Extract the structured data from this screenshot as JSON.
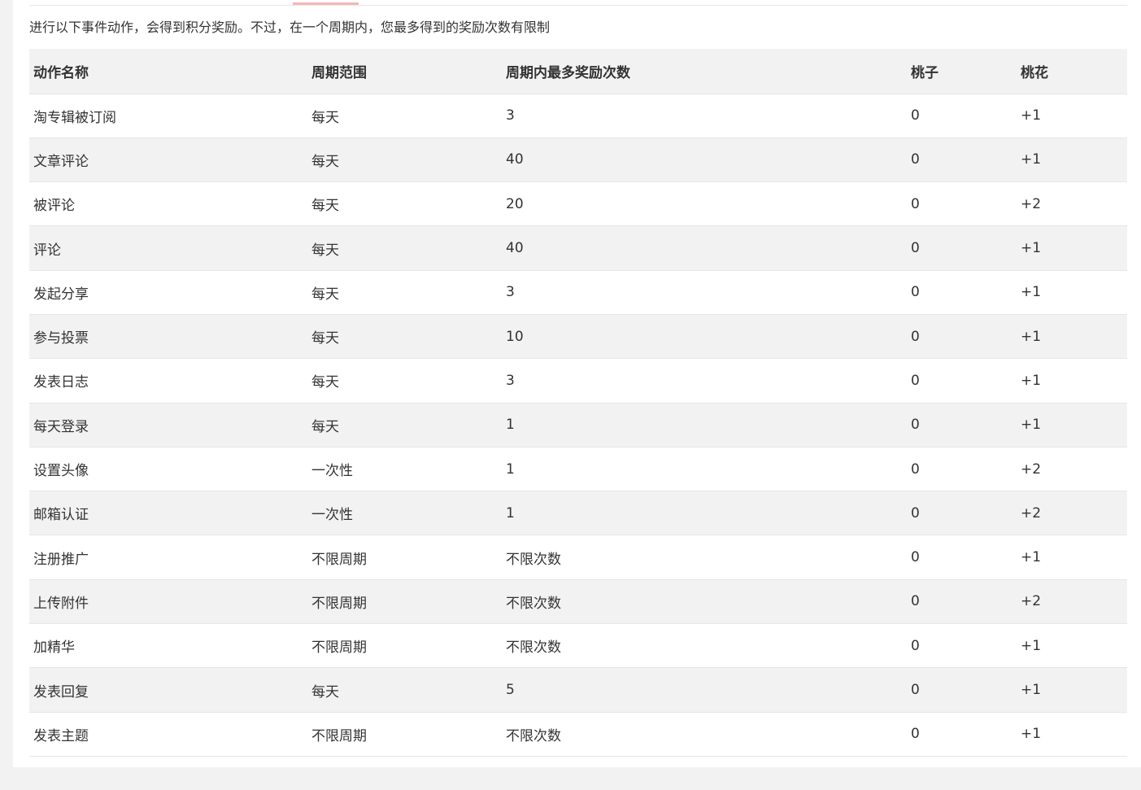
{
  "intro": "进行以下事件动作，会得到积分奖励。不过，在一个周期内，您最多得到的奖励次数有限制",
  "table": {
    "headers": [
      "动作名称",
      "周期范围",
      "周期内最多奖励次数",
      "桃子",
      "桃花"
    ],
    "rows": [
      [
        "淘专辑被订阅",
        "每天",
        "3",
        "0",
        "+1"
      ],
      [
        "文章评论",
        "每天",
        "40",
        "0",
        "+1"
      ],
      [
        "被评论",
        "每天",
        "20",
        "0",
        "+2"
      ],
      [
        "评论",
        "每天",
        "40",
        "0",
        "+1"
      ],
      [
        "发起分享",
        "每天",
        "3",
        "0",
        "+1"
      ],
      [
        "参与投票",
        "每天",
        "10",
        "0",
        "+1"
      ],
      [
        "发表日志",
        "每天",
        "3",
        "0",
        "+1"
      ],
      [
        "每天登录",
        "每天",
        "1",
        "0",
        "+1"
      ],
      [
        "设置头像",
        "一次性",
        "1",
        "0",
        "+2"
      ],
      [
        "邮箱认证",
        "一次性",
        "1",
        "0",
        "+2"
      ],
      [
        "注册推广",
        "不限周期",
        "不限次数",
        "0",
        "+1"
      ],
      [
        "上传附件",
        "不限周期",
        "不限次数",
        "0",
        "+2"
      ],
      [
        "加精华",
        "不限周期",
        "不限次数",
        "0",
        "+1"
      ],
      [
        "发表回复",
        "每天",
        "5",
        "0",
        "+1"
      ],
      [
        "发表主题",
        "不限周期",
        "不限次数",
        "0",
        "+1"
      ]
    ]
  }
}
